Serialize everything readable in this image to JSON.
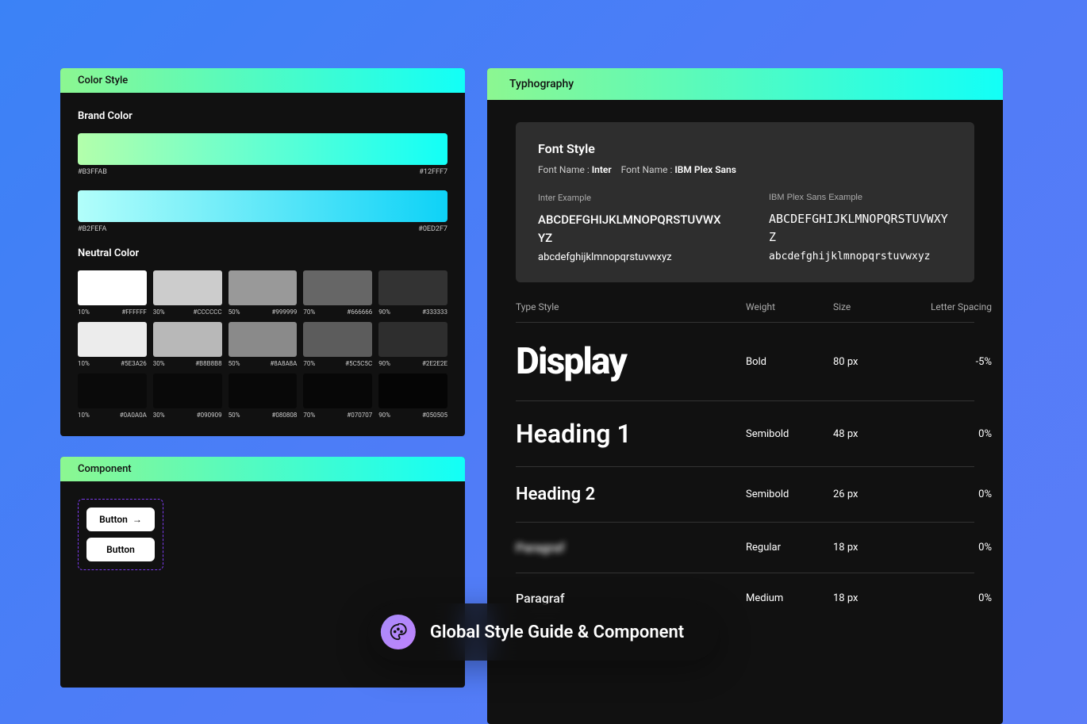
{
  "colorPanel": {
    "title": "Color Style",
    "brand": {
      "title": "Brand Color",
      "gradients": [
        {
          "start": "#B3FFAB",
          "end": "#12FFF7"
        },
        {
          "start": "#B2FEFA",
          "end": "#0ED2F7"
        }
      ]
    },
    "neutral": {
      "title": "Neutral Color",
      "rows": [
        [
          {
            "pct": "10%",
            "hex": "#FFFFFF",
            "bg": "#FFFFFF"
          },
          {
            "pct": "30%",
            "hex": "#CCCCCC",
            "bg": "#CCCCCC"
          },
          {
            "pct": "50%",
            "hex": "#999999",
            "bg": "#999999"
          },
          {
            "pct": "70%",
            "hex": "#666666",
            "bg": "#666666"
          },
          {
            "pct": "90%",
            "hex": "#333333",
            "bg": "#333333"
          }
        ],
        [
          {
            "pct": "10%",
            "hex": "#5E3A26",
            "bg": "#ECECEC"
          },
          {
            "pct": "30%",
            "hex": "#B8B8B8",
            "bg": "#B8B8B8"
          },
          {
            "pct": "50%",
            "hex": "#8A8A8A",
            "bg": "#8A8A8A"
          },
          {
            "pct": "70%",
            "hex": "#5C5C5C",
            "bg": "#5C5C5C"
          },
          {
            "pct": "90%",
            "hex": "#2E2E2E",
            "bg": "#2E2E2E"
          }
        ],
        [
          {
            "pct": "10%",
            "hex": "#0A0A0A",
            "bg": "#0A0A0A"
          },
          {
            "pct": "30%",
            "hex": "#090909",
            "bg": "#090909"
          },
          {
            "pct": "50%",
            "hex": "#080808",
            "bg": "#080808"
          },
          {
            "pct": "70%",
            "hex": "#070707",
            "bg": "#070707"
          },
          {
            "pct": "90%",
            "hex": "#050505",
            "bg": "#050505"
          }
        ]
      ]
    }
  },
  "componentPanel": {
    "title": "Component",
    "buttons": [
      {
        "label": "Button",
        "arrow": true
      },
      {
        "label": "Button",
        "arrow": false
      }
    ]
  },
  "typographyPanel": {
    "title": "Typhography",
    "fontBlock": {
      "title": "Font Style",
      "name1Label": "Font Name :",
      "name1": "Inter",
      "name2Label": "Font Name :",
      "name2": "IBM Plex Sans",
      "ex1Label": "Inter Example",
      "ex2Label": "IBM Plex Sans Example",
      "upper": "ABCDEFGHIJKLMNOPQRSTUVWXYZ",
      "lower": "abcdefghijklmnopqrstuvwxyz"
    },
    "tableHeaders": [
      "Type Style",
      "Weight",
      "Size",
      "Letter Spacing"
    ],
    "rows": [
      {
        "name": "Display",
        "cls": "display-text",
        "weight": "Bold",
        "size": "80 px",
        "ls": "-5%"
      },
      {
        "name": "Heading 1",
        "cls": "h1-text",
        "weight": "Semibold",
        "size": "48 px",
        "ls": "0%"
      },
      {
        "name": "Heading 2",
        "cls": "h2-text",
        "weight": "Semibold",
        "size": "26 px",
        "ls": "0%"
      },
      {
        "name": "Paragraf",
        "cls": "para-text blurred",
        "weight": "Regular",
        "size": "18 px",
        "ls": "0%"
      },
      {
        "name": "Paragraf",
        "cls": "para-text",
        "weight": "Medium",
        "size": "18 px",
        "ls": "0%"
      }
    ]
  },
  "pill": {
    "label": "Global Style Guide & Component"
  }
}
